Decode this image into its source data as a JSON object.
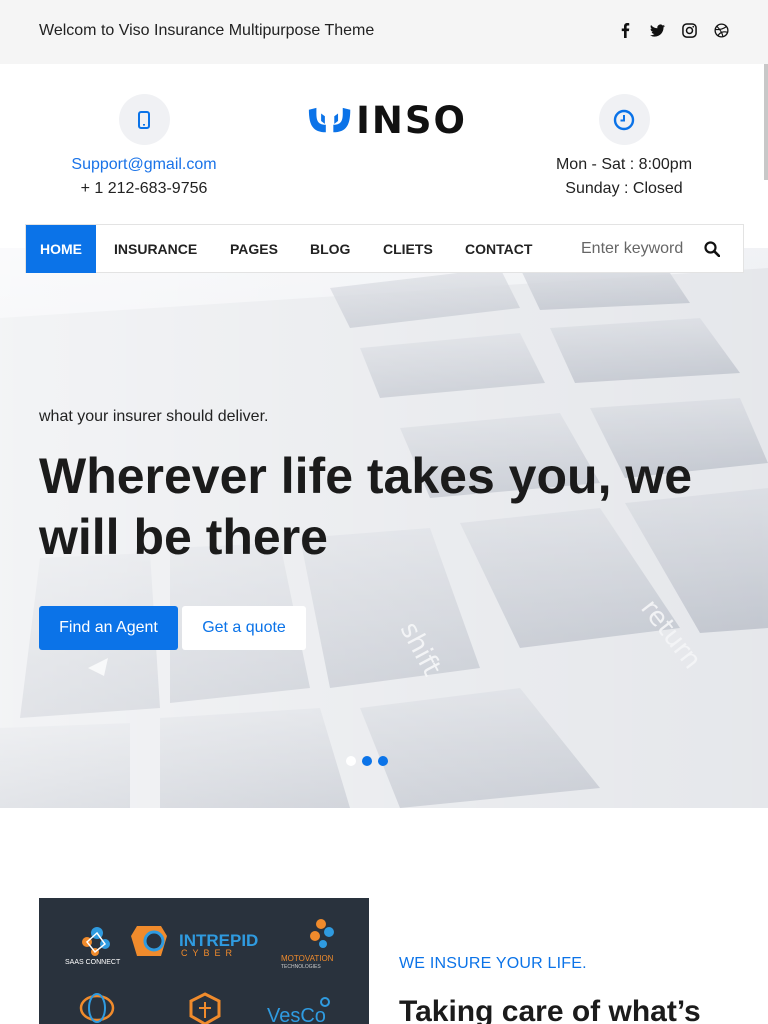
{
  "topbar": {
    "welcome": "Welcom to Viso Insurance Multipurpose Theme",
    "social": [
      "facebook-icon",
      "twitter-icon",
      "instagram-icon",
      "dribbble-icon"
    ]
  },
  "contact": {
    "email": "Support@gmail.com",
    "phone": "+ 1 212-683-9756",
    "icon": "phone-icon"
  },
  "logo": {
    "text": "INSO"
  },
  "hours": {
    "weekday": "Mon - Sat : 8:00pm",
    "sunday": "Sunday : Closed",
    "icon": "clock-icon"
  },
  "nav": {
    "items": [
      "HOME",
      "INSURANCE",
      "PAGES",
      "BLOG",
      "CLIETS",
      "CONTACT"
    ],
    "active": "HOME",
    "search_placeholder": "Enter keyword"
  },
  "hero": {
    "subtitle": "what your insurer should deliver.",
    "title": "Wherever life takes you, we will be there",
    "primary_button": "Find an Agent",
    "secondary_button": "Get a quote",
    "slides": 3,
    "active_slide": 3
  },
  "partners": {
    "logos": [
      "SAAS CONNECT",
      "INTREPID",
      "CYBER",
      "MOTOVATION",
      "TECHNOLOGIES",
      "VesCo"
    ]
  },
  "about": {
    "subtitle": "WE INSURE YOUR LIFE.",
    "title": "Taking care of what’s"
  },
  "colors": {
    "accent": "#0b73e8",
    "topbar_bg": "#f5f5f5",
    "panel_bg": "#29323d"
  }
}
